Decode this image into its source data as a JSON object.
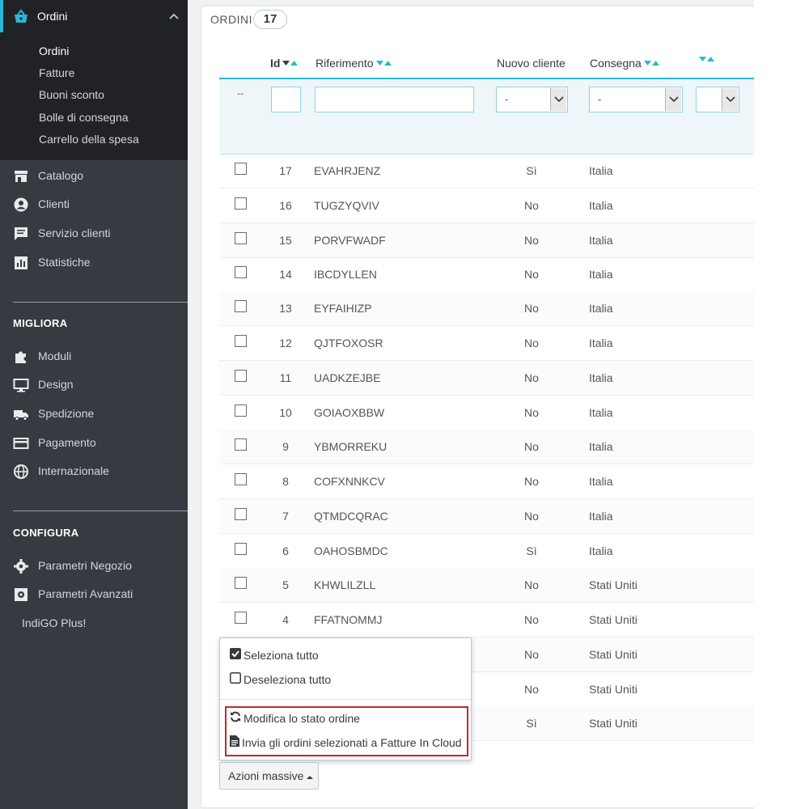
{
  "sidebar": {
    "active_section": {
      "label": "Ordini"
    },
    "sub_items": [
      "Ordini",
      "Fatture",
      "Buoni sconto",
      "Bolle di consegna",
      "Carrello della spesa"
    ],
    "main_items": [
      {
        "label": "Catalogo",
        "icon": "store-icon"
      },
      {
        "label": "Clienti",
        "icon": "user-icon"
      },
      {
        "label": "Servizio clienti",
        "icon": "chat-icon"
      },
      {
        "label": "Statistiche",
        "icon": "chart-icon"
      }
    ],
    "section_improve": {
      "title": "MIGLIORA",
      "items": [
        {
          "label": "Moduli",
          "icon": "puzzle-icon"
        },
        {
          "label": "Design",
          "icon": "monitor-icon"
        },
        {
          "label": "Spedizione",
          "icon": "truck-icon"
        },
        {
          "label": "Pagamento",
          "icon": "card-icon"
        },
        {
          "label": "Internazionale",
          "icon": "globe-icon"
        }
      ]
    },
    "section_configure": {
      "title": "CONFIGURA",
      "items": [
        {
          "label": "Parametri Negozio",
          "icon": "gear-icon"
        },
        {
          "label": "Parametri Avanzati",
          "icon": "cog-box-icon"
        }
      ],
      "extra": "IndiGO Plus!"
    }
  },
  "panel": {
    "title": "ORDINI",
    "count": "17"
  },
  "table": {
    "headers": {
      "id": "Id",
      "reference": "Riferimento",
      "new_customer": "Nuovo cliente",
      "delivery": "Consegna"
    },
    "filters": {
      "dash": "--",
      "id_value": "",
      "reference_value": "",
      "new_customer_value": "-",
      "delivery_value": "-"
    },
    "rows": [
      {
        "id": "17",
        "reference": "EVAHRJENZ",
        "new_customer": "Sì",
        "delivery": "Italia"
      },
      {
        "id": "16",
        "reference": "TUGZYQVIV",
        "new_customer": "No",
        "delivery": "Italia"
      },
      {
        "id": "15",
        "reference": "PORVFWADF",
        "new_customer": "No",
        "delivery": "Italia"
      },
      {
        "id": "14",
        "reference": "IBCDYLLEN",
        "new_customer": "No",
        "delivery": "Italia"
      },
      {
        "id": "13",
        "reference": "EYFAIHIZP",
        "new_customer": "No",
        "delivery": "Italia"
      },
      {
        "id": "12",
        "reference": "QJTFOXOSR",
        "new_customer": "No",
        "delivery": "Italia"
      },
      {
        "id": "11",
        "reference": "UADKZEJBE",
        "new_customer": "No",
        "delivery": "Italia"
      },
      {
        "id": "10",
        "reference": "GOIAOXBBW",
        "new_customer": "No",
        "delivery": "Italia"
      },
      {
        "id": "9",
        "reference": "YBMORREKU",
        "new_customer": "No",
        "delivery": "Italia"
      },
      {
        "id": "8",
        "reference": "COFXNNKCV",
        "new_customer": "No",
        "delivery": "Italia"
      },
      {
        "id": "7",
        "reference": "QTMDCQRAC",
        "new_customer": "No",
        "delivery": "Italia"
      },
      {
        "id": "6",
        "reference": "OAHOSBMDC",
        "new_customer": "Sì",
        "delivery": "Italia"
      },
      {
        "id": "5",
        "reference": "KHWLILZLL",
        "new_customer": "No",
        "delivery": "Stati Uniti"
      },
      {
        "id": "4",
        "reference": "FFATNOMMJ",
        "new_customer": "No",
        "delivery": "Stati Uniti"
      },
      {
        "id": "",
        "reference": "",
        "new_customer": "No",
        "delivery": "Stati Uniti"
      },
      {
        "id": "",
        "reference": "",
        "new_customer": "No",
        "delivery": "Stati Uniti"
      },
      {
        "id": "",
        "reference": "",
        "new_customer": "Sì",
        "delivery": "Stati Uniti"
      }
    ]
  },
  "bulk_actions": {
    "button_label": "Azioni massive",
    "menu": {
      "select_all": "Seleziona tutto",
      "deselect_all": "Deseleziona tutto",
      "change_status": "Modifica lo stato ordine",
      "send_to_fic": "Invia gli ordini selezionati a Fatture In Cloud"
    }
  },
  "colors": {
    "sidebar_bg": "#363a41",
    "accent": "#25b9d7",
    "highlight_border": "#c02a2a"
  }
}
